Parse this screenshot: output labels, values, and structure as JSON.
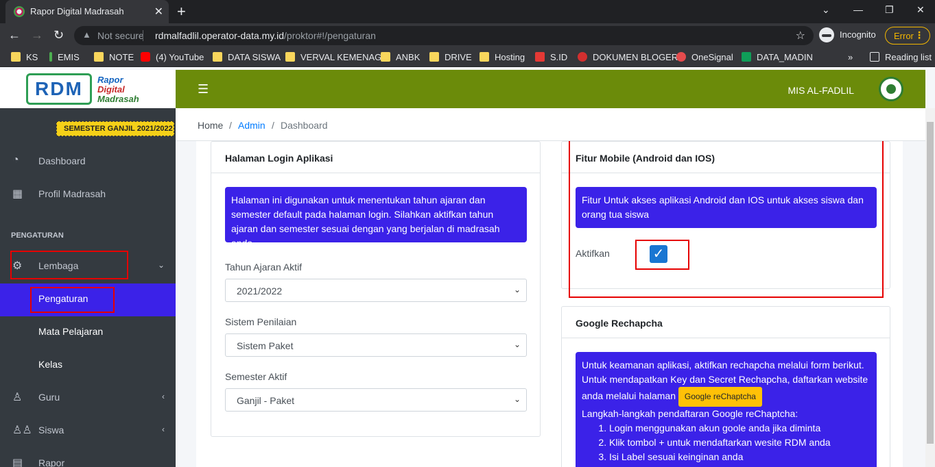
{
  "browser": {
    "tab_title": "Rapor Digital Madrasah",
    "not_secure": "Not secure",
    "url_host": "rdmalfadlil.operator-data.my.id",
    "url_path": "/proktor#!/pengaturan",
    "incognito": "Incognito",
    "error_label": "Error",
    "bookmarks": [
      "KS",
      "EMIS",
      "NOTE",
      "(4) YouTube",
      "DATA SISWA",
      "VERVAL KEMENAG",
      "ANBK",
      "DRIVE",
      "Hosting",
      "S.ID",
      "DOKUMEN BLOGER",
      "OneSignal",
      "DATA_MADIN"
    ],
    "reading_list": "Reading list",
    "more": "»"
  },
  "brand": {
    "logo_letters": "RDM",
    "line1": "Rapor",
    "line2": "Digital",
    "line3": "Madrasah"
  },
  "semester_badge": "SEMESTER GANJIL 2021/2022",
  "sidebar": {
    "dashboard": "Dashboard",
    "profil": "Profil Madrasah",
    "section_header": "PENGATURAN",
    "lembaga": "Lembaga",
    "pengaturan": "Pengaturan",
    "mapel": "Mata Pelajaran",
    "kelas": "Kelas",
    "guru": "Guru",
    "siswa": "Siswa",
    "rapor": "Rapor"
  },
  "topnav": {
    "school": "MIS AL-FADLIL"
  },
  "breadcrumb": {
    "home": "Home",
    "admin": "Admin",
    "current": "Dashboard",
    "sep": "/"
  },
  "login_card": {
    "title": "Halaman Login Aplikasi",
    "info": "Halaman ini digunakan untuk menentukan tahun ajaran dan semester default pada halaman login. Silahkan aktifkan tahun ajaran dan semester sesuai dengan yang berjalan di madrasah anda.",
    "tahun_label": "Tahun Ajaran Aktif",
    "tahun_value": "2021/2022",
    "sistem_label": "Sistem Penilaian",
    "sistem_value": "Sistem Paket",
    "semester_label": "Semester Aktif",
    "semester_value": "Ganjil - Paket"
  },
  "mobile_card": {
    "title": "Fitur Mobile (Android dan IOS)",
    "info": "Fitur Untuk akses aplikasi Android dan IOS untuk akses siswa dan orang tua siswa",
    "aktifkan_label": "Aktifkan",
    "aktifkan_checked": true
  },
  "recaptcha_card": {
    "title": "Google Rechapcha",
    "info_line1": "Untuk keamanan aplikasi, aktifkan rechapcha melalui form berikut. Untuk mendapatkan Key dan Secret Rechapcha, daftarkan website anda melalui halaman",
    "button": "Google reChaptcha",
    "steps_title": "Langkah-langkah pendaftaran Google reChaptcha:",
    "steps": [
      "Login menggunakan akun goole anda jika diminta",
      "Klik tombol + untuk mendaftarkan wesite RDM anda",
      "Isi Label sesuai keinginan anda"
    ]
  }
}
